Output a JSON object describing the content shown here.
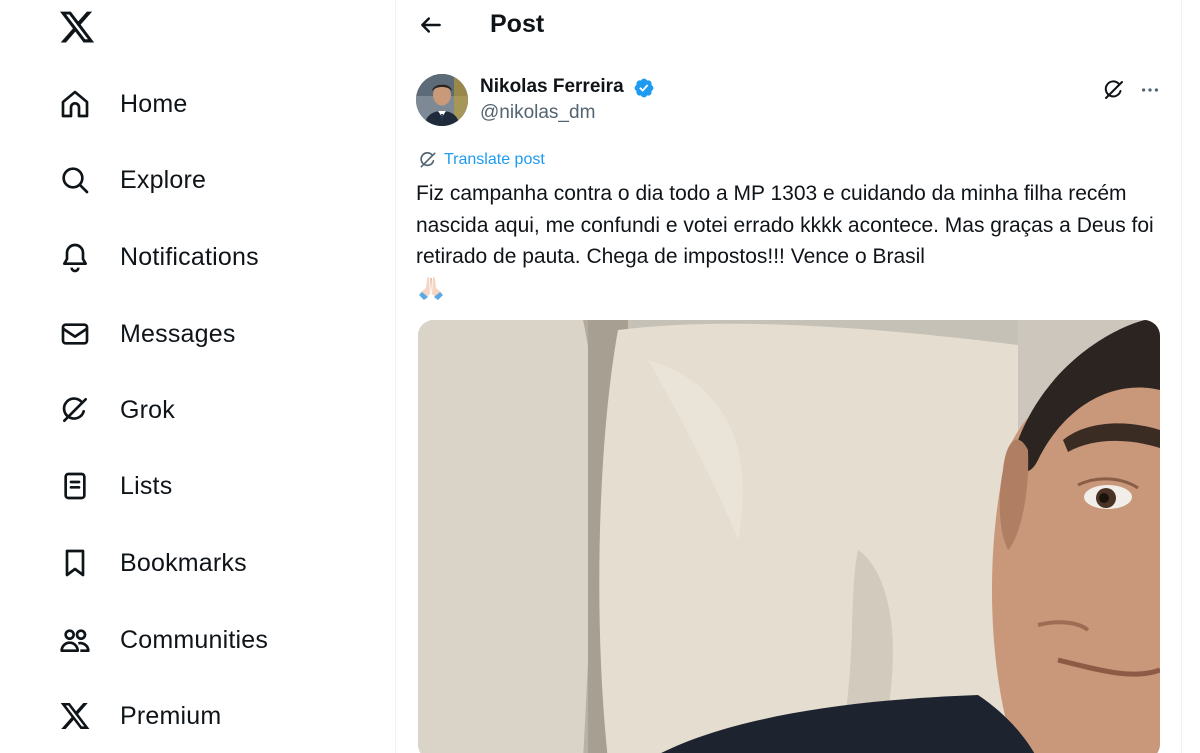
{
  "sidebar": {
    "items": [
      {
        "label": "Home",
        "icon": "home-icon"
      },
      {
        "label": "Explore",
        "icon": "search-icon"
      },
      {
        "label": "Notifications",
        "icon": "bell-icon"
      },
      {
        "label": "Messages",
        "icon": "envelope-icon"
      },
      {
        "label": "Grok",
        "icon": "grok-icon"
      },
      {
        "label": "Lists",
        "icon": "list-icon"
      },
      {
        "label": "Bookmarks",
        "icon": "bookmark-icon"
      },
      {
        "label": "Communities",
        "icon": "communities-icon"
      },
      {
        "label": "Premium",
        "icon": "x-logo-icon"
      }
    ]
  },
  "header": {
    "title": "Post"
  },
  "post": {
    "author_name": "Nikolas Ferreira",
    "author_handle": "@nikolas_dm",
    "translate_label": "Translate post",
    "text": "Fiz campanha contra o dia todo a MP 1303 e cuidando da minha filha recém nascida aqui, me confundi e votei errado kkkk acontece. Mas graças a Deus foi retirado de pauta. Chega de impostos!!! Vence o Brasil",
    "emoji": "folded-hands-emoji"
  },
  "colors": {
    "text": "#0f1419",
    "secondary": "#536471",
    "accent": "#1d9bf0",
    "divider": "#eff3f4"
  }
}
